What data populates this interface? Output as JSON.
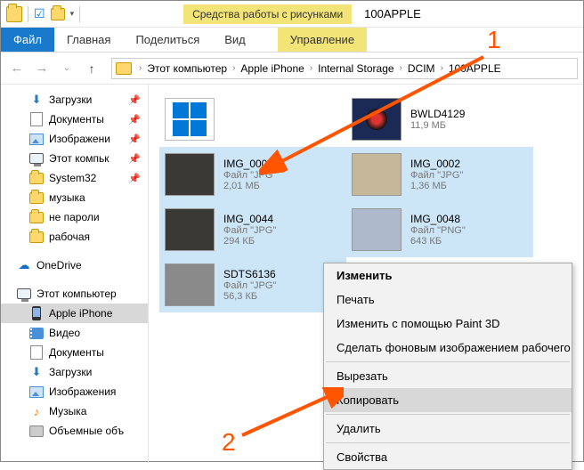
{
  "titlebar": {
    "context_tools": "Средства работы с рисунками",
    "window_title": "100APPLE"
  },
  "ribbon": {
    "file": "Файл",
    "home": "Главная",
    "share": "Поделиться",
    "view": "Вид",
    "manage": "Управление"
  },
  "breadcrumb": [
    "Этот компьютер",
    "Apple iPhone",
    "Internal Storage",
    "DCIM",
    "100APPLE"
  ],
  "sidebar": {
    "quick": {
      "downloads": "Загрузки",
      "documents": "Документы",
      "pictures": "Изображени",
      "thispc": "Этот компьк",
      "system32": "System32",
      "music": "музыка",
      "passwords": "не пароли",
      "work": "рабочая"
    },
    "onedrive": "OneDrive",
    "thispc": "Этот компьютер",
    "iphone": "Apple iPhone",
    "video": "Видео",
    "documents": "Документы",
    "downloads": "Загрузки",
    "pictures": "Изображения",
    "music": "Музыка",
    "volumes": "Объемные объ"
  },
  "files": [
    {
      "name": "",
      "type": "",
      "size": "",
      "thumb": "drive",
      "selected": false
    },
    {
      "name": "BWLD4129",
      "type": "",
      "size": "11,9 МБ",
      "thumb": "video",
      "selected": false
    },
    {
      "name": "IMG_0001",
      "type": "Файл \"JPG\"",
      "size": "2,01 МБ",
      "thumb": "dark",
      "selected": true
    },
    {
      "name": "IMG_0002",
      "type": "Файл \"JPG\"",
      "size": "1,36 МБ",
      "thumb": "tan",
      "selected": true
    },
    {
      "name": "IMG_0044",
      "type": "Файл \"JPG\"",
      "size": "294 КБ",
      "thumb": "dark",
      "selected": true
    },
    {
      "name": "IMG_0048",
      "type": "Файл \"PNG\"",
      "size": "643 КБ",
      "thumb": "light",
      "selected": true
    },
    {
      "name": "SDTS6136",
      "type": "Файл \"JPG\"",
      "size": "56,3 КБ",
      "thumb": "gray",
      "selected": true
    }
  ],
  "context_menu": {
    "edit": "Изменить",
    "print": "Печать",
    "paint3d": "Изменить с помощью Paint 3D",
    "wallpaper": "Сделать фоновым изображением рабочего стола",
    "cut": "Вырезать",
    "copy": "Копировать",
    "delete": "Удалить",
    "properties": "Свойства"
  },
  "annotations": {
    "one": "1",
    "two": "2"
  }
}
